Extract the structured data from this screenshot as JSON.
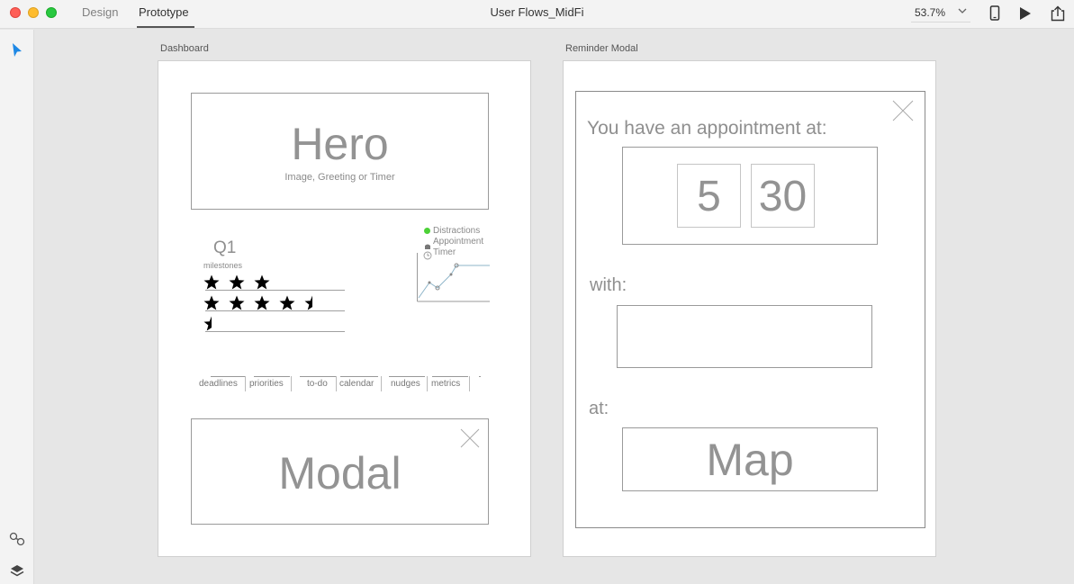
{
  "window": {
    "mode_tabs": [
      "Design",
      "Prototype"
    ],
    "active_mode": "Prototype",
    "title": "User Flows_MidFi",
    "zoom": "53.7%"
  },
  "icons": {
    "select_tool": "cursor-arrow-icon",
    "links": "link-icon",
    "layers": "layers-icon",
    "device_preview": "phone-icon",
    "play": "play-icon",
    "share": "share-icon",
    "zoom_dropdown": "chevron-down-icon"
  },
  "colors": {
    "accent": "#1e88e5",
    "wireframe_text": "#939393",
    "chart_line": "#8cb4c8",
    "distractions_dot": "#4cd137"
  },
  "dashboard": {
    "label": "Dashboard",
    "hero": {
      "title": "Hero",
      "subtitle": "Image, Greeting or Timer"
    },
    "milestones": {
      "quarter": "Q1",
      "label": "milestones",
      "ratings": [
        3,
        4.5,
        0.5
      ]
    },
    "legend": [
      "Distractions",
      "Appointment",
      "Timer"
    ],
    "tabs": [
      "deadlines",
      "priorities",
      "to-do",
      "calendar",
      "nudges",
      "metrics"
    ],
    "modal": {
      "title": "Modal"
    }
  },
  "reminder": {
    "label": "Reminder Modal",
    "heading": "You have an appointment at:",
    "hour": "5",
    "minute": "30",
    "with_label": "with:",
    "at_label": "at:",
    "map_label": "Map"
  }
}
